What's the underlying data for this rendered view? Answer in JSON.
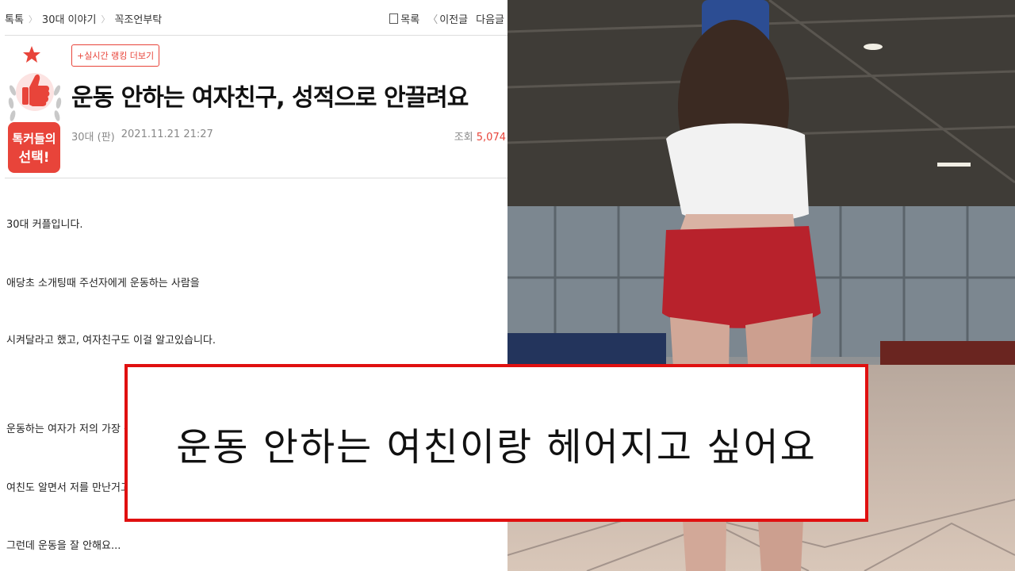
{
  "breadcrumb": {
    "items": [
      "톡톡",
      "30대 이야기",
      "꼭조언부탁"
    ]
  },
  "topnav": {
    "list_label": "목록",
    "prev_label": "이전글",
    "next_label": "다음글"
  },
  "badge": {
    "line1": "톡커들의",
    "line2": "선택!",
    "icons": [
      "star-icon",
      "thumbs-up-icon",
      "laurel-icon"
    ]
  },
  "post": {
    "ranking_button": "+실시간 랭킹 더보기",
    "title": "운동 안하는 여자친구, 성적으로 안끌려요",
    "author": "30대 (판)",
    "date": "2021.11.21 21:27",
    "views_label": "조회",
    "views_value": "5,074"
  },
  "body": {
    "lines": [
      "30대 커플입니다.",
      "애당초 소개팅때 주선자에게 운동하는 사람을",
      "시켜달라고 했고, 여자친구도 이걸 알고있습니다.",
      "운동하는 여자가 저의 가장 큰",
      "여친도 알면서 저를 만난거고",
      "그런데 운동을 잘 안해요..."
    ]
  },
  "caption": {
    "text": "운동 안하는 여친이랑 헤어지고 싶어요"
  },
  "colors": {
    "accent_red": "#e8443a",
    "caption_border": "#e01010"
  }
}
